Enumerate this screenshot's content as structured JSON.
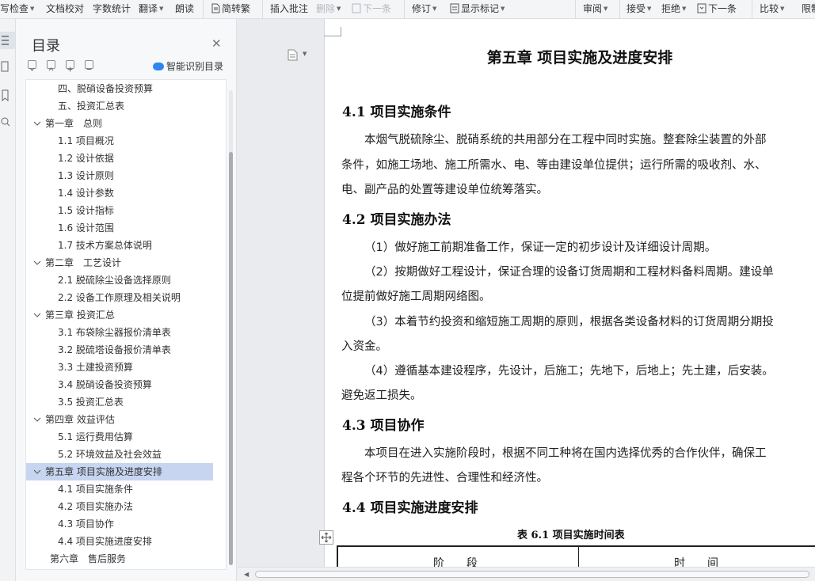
{
  "toolbar": {
    "items": [
      "写检查",
      "文档校对",
      "字数统计",
      "翻译",
      "朗读",
      "简转繁",
      "插入批注",
      "删除",
      "下一条",
      "修订",
      "显示标记",
      "审阅",
      "接受",
      "拒绝",
      "下一条",
      "比较",
      "限制"
    ]
  },
  "toc": {
    "title": "目录",
    "ai_label": "智能识别目录",
    "items": [
      "四、脱硝设备投资预算",
      "五、投资汇总表",
      "第一章　总则",
      "1.1 项目概况",
      "1.2  设计依据",
      "1.3  设计原则",
      "1.4  设计参数",
      "1.5  设计指标",
      "1.6  设计范围",
      "1.7 技术方案总体说明",
      "第二章　工艺设计",
      "2.1 脱硫除尘设备选择原则",
      "2.2 设备工作原理及相关说明",
      "第三章 投资汇总",
      "3.1 布袋除尘器报价清单表",
      "3.2 脱硫塔设备报价清单表",
      "3.3 土建投资预算",
      "3.4 脱硝设备投资预算",
      "3.5 投资汇总表",
      "第四章 效益评估",
      "5.1 运行费用估算",
      "5.2 环境效益及社会效益",
      "第五章  项目实施及进度安排",
      "4.1 项目实施条件",
      "4.2 项目实施办法",
      "4.3 项目协作",
      "4.4 项目实施进度安排",
      "第六章　售后服务"
    ]
  },
  "document": {
    "chapter_title": "第五章  项目实施及进度安排",
    "section_41": "4.1 项目实施条件",
    "p41_line1": "本烟气脱硫除尘、脱硝系统的共用部分在工程中同时实施。整套除尘装置的外部",
    "p41_line2": "条件，如施工场地、施工所需水、电、等由建设单位提供；运行所需的吸收剂、水、",
    "p41_line3": "电、副产品的处置等建设单位统筹落实。",
    "section_42": "4.2 项目实施办法",
    "p42_1": "（1）做好施工前期准备工作，保证一定的初步设计及详细设计周期。",
    "p42_2a": "（2）按期做好工程设计，保证合理的设备订货周期和工程材料备料周期。建设单",
    "p42_2b": "位提前做好施工周期网络图。",
    "p42_3a": "（3）本着节约投资和缩短施工周期的原则，根据各类设备材料的订货周期分期投",
    "p42_3b": "入资金。",
    "p42_4a": "（4）遵循基本建设程序，先设计，后施工；先地下，后地上；先土建，后安装。",
    "p42_4b": "避免返工损失。",
    "section_43": "4.3 项目协作",
    "p43_a": "本项目在进入实施阶段时，根据不同工种将在国内选择优秀的合作伙伴，确保工",
    "p43_b": "程各个环节的先进性、合理性和经济性。",
    "section_44": "4.4 项目实施进度安排",
    "table_caption": "表 6.1   项目实施时间表",
    "table_headers": [
      "阶　　段",
      "时　　间"
    ]
  }
}
